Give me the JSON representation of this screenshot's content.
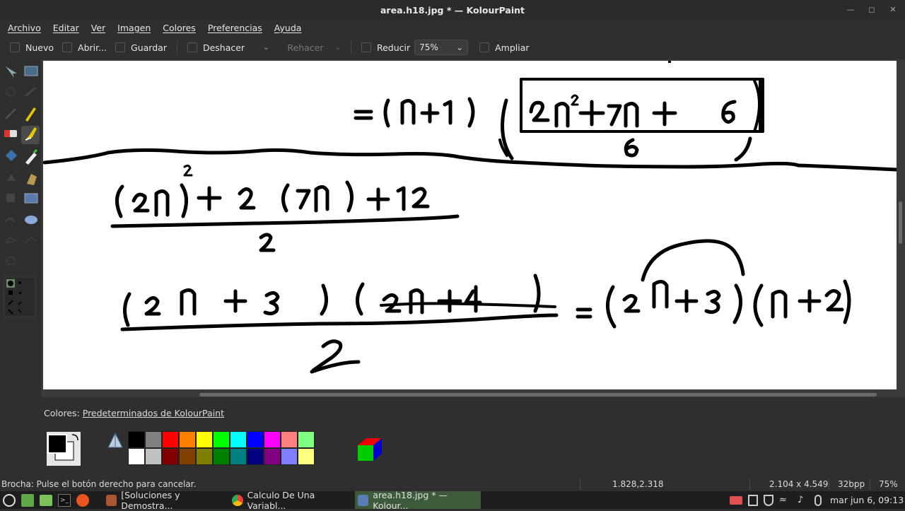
{
  "window": {
    "title": "area.h18.jpg * — KolourPaint"
  },
  "menu": [
    "Archivo",
    "Editar",
    "Ver",
    "Imagen",
    "Colores",
    "Preferencias",
    "Ayuda"
  ],
  "toolbar": {
    "new": "Nuevo",
    "open": "Abrir...",
    "save": "Guardar",
    "undo": "Deshacer",
    "redo": "Rehacer",
    "zoom_out": "Reducir",
    "zoom_value": "75%",
    "zoom_in": "Ampliar"
  },
  "colors_panel": {
    "label_prefix": "Colores: ",
    "label_scheme": "Predeterminados de KolourPaint"
  },
  "palette": {
    "row1": [
      "#000000",
      "#808080",
      "#ff0000",
      "#ff8000",
      "#ffff00",
      "#00ff00",
      "#00ffff",
      "#0000ff",
      "#ff00ff",
      "#ff8080",
      "#80ff80"
    ],
    "row2": [
      "#ffffff",
      "#c0c0c0",
      "#800000",
      "#804000",
      "#808000",
      "#008000",
      "#008080",
      "#000080",
      "#800080",
      "#8080ff",
      "#ffff80"
    ]
  },
  "status": {
    "message": "Brocha: Pulse el botón derecho para cancelar.",
    "cursor": "1.828,2.318",
    "size": "2.104 x 4.549",
    "depth": "32bpp",
    "zoom": "75%"
  },
  "taskbar": {
    "tasks": [
      "[Soluciones y Demostra...",
      "Calculo De Una Variabl...",
      "area.h18.jpg * — Kolour..."
    ],
    "clock": "mar jun  6, 09:13"
  }
}
